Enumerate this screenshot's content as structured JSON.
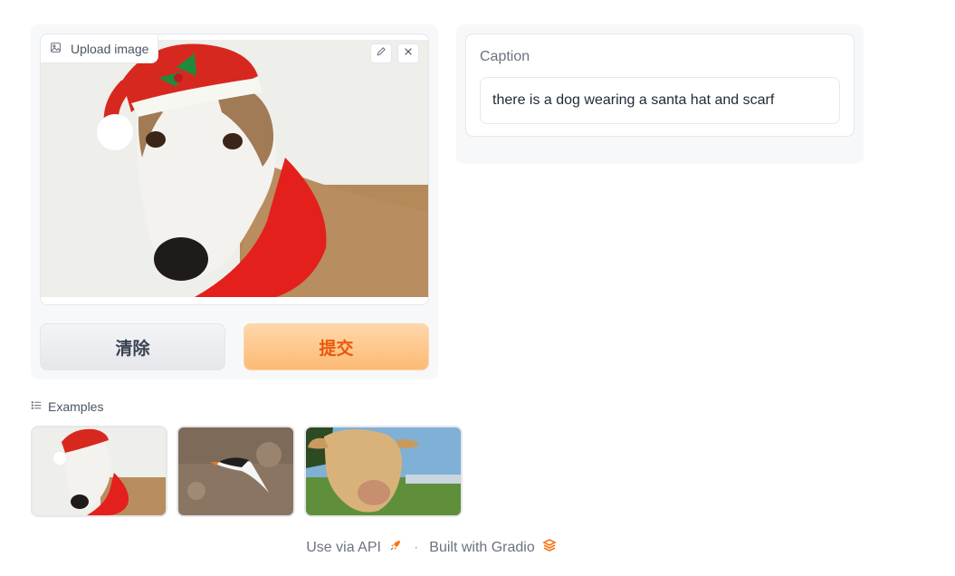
{
  "input": {
    "upload_label": "Upload image",
    "image_icon": "image-icon",
    "edit_icon": "pencil-icon",
    "close_icon": "close-icon"
  },
  "buttons": {
    "clear_label": "清除",
    "submit_label": "提交"
  },
  "output": {
    "label": "Caption",
    "value": "there is a dog wearing a santa hat and scarf"
  },
  "examples": {
    "title": "Examples",
    "icon": "list-icon",
    "items": [
      "dog-with-santa-hat",
      "flying-bird",
      "cow-in-field"
    ]
  },
  "footer": {
    "api_label": "Use via API",
    "separator": "·",
    "built_label": "Built with Gradio"
  },
  "colors": {
    "accent": "#ea580c",
    "submit_bg": "#fdba74"
  }
}
